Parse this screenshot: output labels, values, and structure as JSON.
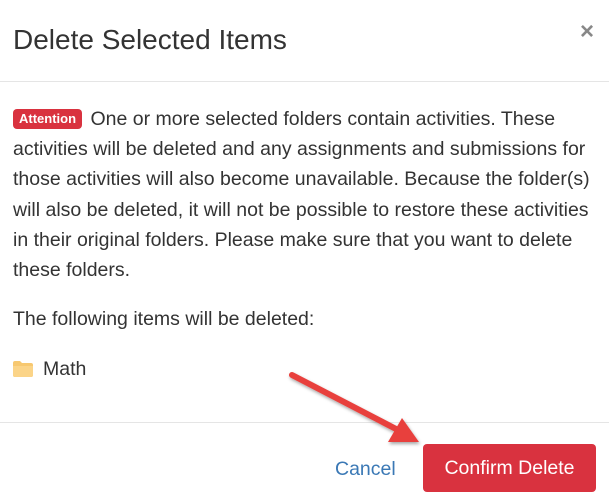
{
  "dialog": {
    "title": "Delete Selected Items",
    "close_symbol": "×"
  },
  "body": {
    "badge": "Attention",
    "message": "One or more selected folders contain activities. These activities will be deleted and any assignments and submissions for those activities will also become unavailable. Because the folder(s) will also be deleted, it will not be possible to restore these activities in their original folders. Please make sure that you want to delete these folders.",
    "items_label": "The following items will be deleted:",
    "items": [
      {
        "name": "Math",
        "icon": "folder-icon"
      }
    ]
  },
  "footer": {
    "cancel_label": "Cancel",
    "confirm_label": "Confirm Delete"
  },
  "colors": {
    "danger": "#d9323f",
    "link": "#3a78b5",
    "folder": "#f7c870",
    "annotation_arrow": "#e8403c"
  }
}
